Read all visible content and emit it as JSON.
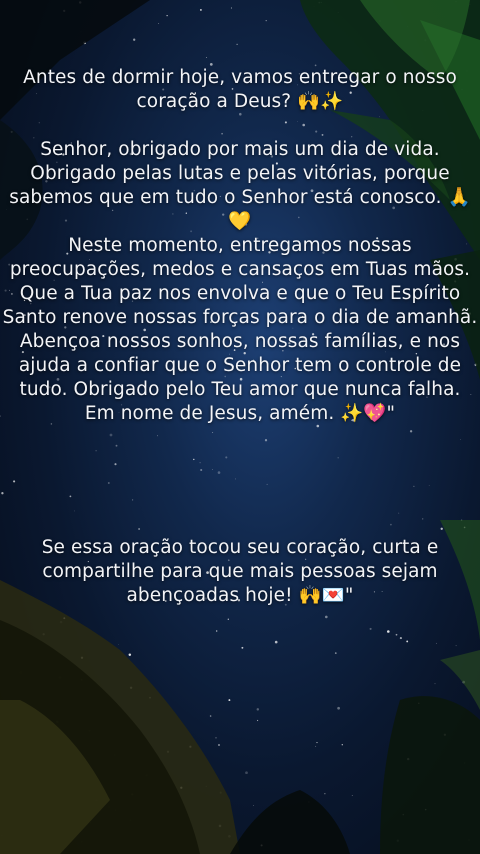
{
  "caption": {
    "intro": [
      "Antes de dormir hoje, vamos entregar o nosso",
      "coração a Deus? 🙌✨"
    ],
    "prayer": [
      "Senhor, obrigado por mais um dia de vida.",
      "Obrigado pelas lutas e pelas vitórias, porque",
      "sabemos que em tudo o Senhor está conosco. 🙏",
      "💛",
      "Neste momento, entregamos nossas",
      "preocupações, medos e cansaços em Tuas mãos.",
      "Que a Tua paz nos envolva e que o Teu Espírito",
      "Santo renove nossas forças para o dia de amanhã.",
      "Abençoa nossos sonhos, nossas famílias, e nos",
      "ajuda a confiar que o Senhor tem o controle de",
      "tudo. Obrigado pelo Teu amor que nunca falha.",
      "Em nome de Jesus, amém. ✨💖\""
    ],
    "call_to_action": [
      "Se essa oração tocou seu coração, curta e",
      "compartilhe para que mais pessoas sejam",
      "abençoadas hoje! 🙌💌\""
    ]
  },
  "colors": {
    "text": "#f3f4f7",
    "sky": "#11284c"
  }
}
